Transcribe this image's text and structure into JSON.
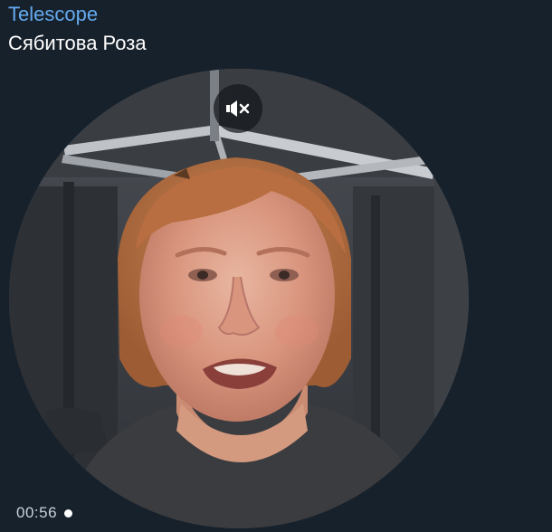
{
  "channel": {
    "name": "Telescope"
  },
  "message": {
    "sender": "Сябитова Роза"
  },
  "video": {
    "duration": "00:56",
    "muted": true,
    "unread": true,
    "mute_icon": "speaker-muted-icon"
  },
  "colors": {
    "background": "#17212b",
    "channel_name": "#64aaf0",
    "sender_name": "#ffffff",
    "duration_text": "#c9d2db"
  }
}
